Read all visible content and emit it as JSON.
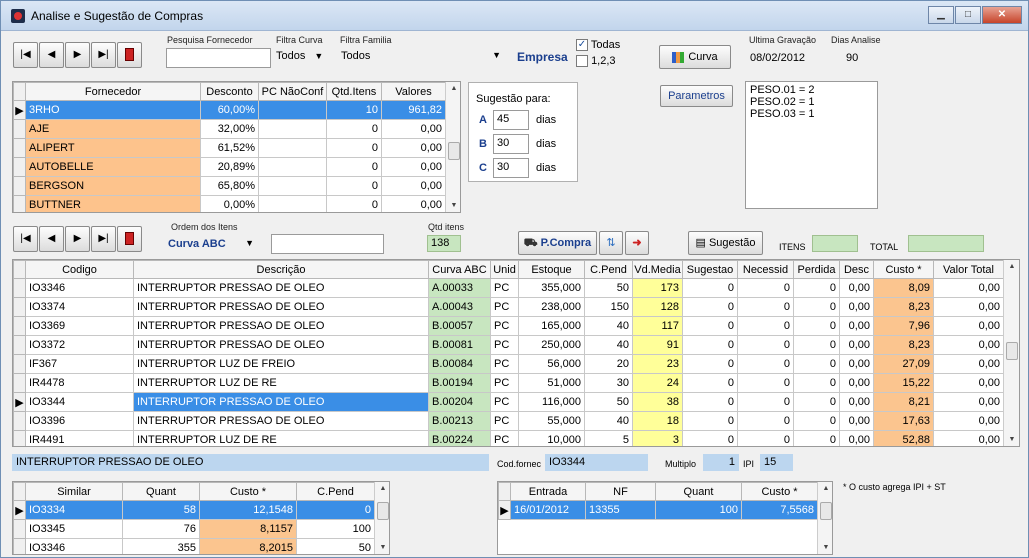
{
  "window": {
    "title": "Analise e Sugestão de Compras"
  },
  "top": {
    "pesquisa_label": "Pesquisa Fornecedor",
    "pesquisa_value": "",
    "filtra_curva_label": "Filtra Curva",
    "filtra_curva_value": "Todos",
    "filtra_familia_label": "Filtra Familia",
    "filtra_familia_value": "Todos",
    "empresa_label": "Empresa",
    "todas_label": "Todas",
    "todas_checked": true,
    "opt123_label": "1,2,3",
    "opt123_checked": false,
    "curva_button": "Curva",
    "ultima_label": "Ultima Gravação",
    "ultima_value": "08/02/2012",
    "dias_label": "Dias Analise",
    "dias_value": "90"
  },
  "fornecedores": {
    "headers": [
      "Fornecedor",
      "Desconto",
      "PC NãoConf",
      "Qtd.Itens",
      "Valores"
    ],
    "rows": [
      {
        "nome": "3RHO",
        "desconto": "60,00%",
        "pc": "",
        "qtd": "10",
        "valor": "961,82"
      },
      {
        "nome": "AJE",
        "desconto": "32,00%",
        "pc": "",
        "qtd": "0",
        "valor": "0,00"
      },
      {
        "nome": "ALIPERT",
        "desconto": "61,52%",
        "pc": "",
        "qtd": "0",
        "valor": "0,00"
      },
      {
        "nome": "AUTOBELLE",
        "desconto": "20,89%",
        "pc": "",
        "qtd": "0",
        "valor": "0,00"
      },
      {
        "nome": "BERGSON",
        "desconto": "65,80%",
        "pc": "",
        "qtd": "0",
        "valor": "0,00"
      },
      {
        "nome": "BUTTNER",
        "desconto": "0,00%",
        "pc": "",
        "qtd": "0",
        "valor": "0,00"
      }
    ]
  },
  "sugestao": {
    "title": "Sugestão para:",
    "unit": "dias",
    "a_label": "A",
    "a_value": "45",
    "b_label": "B",
    "b_value": "30",
    "c_label": "C",
    "c_value": "30"
  },
  "parametros": {
    "button": "Parametros",
    "lines": [
      "PESO.01 = 2",
      "PESO.02 = 1",
      "PESO.03 = 1"
    ]
  },
  "itens_bar": {
    "ordem_label": "Ordem dos Itens",
    "ordem_value": "Curva ABC",
    "ordem_search": "",
    "qtd_label": "Qtd itens",
    "qtd_value": "138",
    "pcompra_button": "P.Compra",
    "sugestao_button": "Sugestão",
    "itens_label": "ITENS",
    "itens_value": "",
    "total_label": "TOTAL",
    "total_value": ""
  },
  "itens": {
    "headers": [
      "Codigo",
      "Descrição",
      "Curva ABC",
      "Unid",
      "Estoque",
      "C.Pend",
      "Vd.Media",
      "Sugestao",
      "Necessid",
      "Perdida",
      "Desc",
      "Custo *",
      "Valor Total"
    ],
    "rows": [
      {
        "codigo": "IO3346",
        "descricao": "INTERRUPTOR PRESSAO DE OLEO",
        "curva": "A.00033",
        "unid": "PC",
        "estoque": "355,000",
        "cpend": "50",
        "vd": "173",
        "sug": "0",
        "nec": "0",
        "per": "0",
        "desc": "0,00",
        "custo": "8,09",
        "valor": "0,00"
      },
      {
        "codigo": "IO3374",
        "descricao": "INTERRUPTOR PRESSAO DE OLEO",
        "curva": "A.00043",
        "unid": "PC",
        "estoque": "238,000",
        "cpend": "150",
        "vd": "128",
        "sug": "0",
        "nec": "0",
        "per": "0",
        "desc": "0,00",
        "custo": "8,23",
        "valor": "0,00"
      },
      {
        "codigo": "IO3369",
        "descricao": "INTERRUPTOR PRESSAO DE OLEO",
        "curva": "B.00057",
        "unid": "PC",
        "estoque": "165,000",
        "cpend": "40",
        "vd": "117",
        "sug": "0",
        "nec": "0",
        "per": "0",
        "desc": "0,00",
        "custo": "7,96",
        "valor": "0,00"
      },
      {
        "codigo": "IO3372",
        "descricao": "INTERRUPTOR PRESSAO DE OLEO",
        "curva": "B.00081",
        "unid": "PC",
        "estoque": "250,000",
        "cpend": "40",
        "vd": "91",
        "sug": "0",
        "nec": "0",
        "per": "0",
        "desc": "0,00",
        "custo": "8,23",
        "valor": "0,00"
      },
      {
        "codigo": "IF367",
        "descricao": "INTERRUPTOR LUZ DE FREIO",
        "curva": "B.00084",
        "unid": "PC",
        "estoque": "56,000",
        "cpend": "20",
        "vd": "23",
        "sug": "0",
        "nec": "0",
        "per": "0",
        "desc": "0,00",
        "custo": "27,09",
        "valor": "0,00"
      },
      {
        "codigo": "IR4478",
        "descricao": "INTERRUPTOR LUZ DE RE",
        "curva": "B.00194",
        "unid": "PC",
        "estoque": "51,000",
        "cpend": "30",
        "vd": "24",
        "sug": "0",
        "nec": "0",
        "per": "0",
        "desc": "0,00",
        "custo": "15,22",
        "valor": "0,00"
      },
      {
        "codigo": "IO3344",
        "descricao": "INTERRUPTOR PRESSAO DE OLEO",
        "curva": "B.00204",
        "unid": "PC",
        "estoque": "116,000",
        "cpend": "50",
        "vd": "38",
        "sug": "0",
        "nec": "0",
        "per": "0",
        "desc": "0,00",
        "custo": "8,21",
        "valor": "0,00"
      },
      {
        "codigo": "IO3396",
        "descricao": "INTERRUPTOR PRESSAO DE OLEO",
        "curva": "B.00213",
        "unid": "PC",
        "estoque": "55,000",
        "cpend": "40",
        "vd": "18",
        "sug": "0",
        "nec": "0",
        "per": "0",
        "desc": "0,00",
        "custo": "17,63",
        "valor": "0,00"
      },
      {
        "codigo": "IR4491",
        "descricao": "INTERRUPTOR LUZ DE RE",
        "curva": "B.00224",
        "unid": "PC",
        "estoque": "10,000",
        "cpend": "5",
        "vd": "3",
        "sug": "0",
        "nec": "0",
        "per": "0",
        "desc": "0,00",
        "custo": "52,88",
        "valor": "0,00"
      }
    ]
  },
  "detail": {
    "descricao": "INTERRUPTOR PRESSAO DE OLEO",
    "codfornec_label": "Cod.fornec",
    "codfornec_value": "IO3344",
    "multiplo_label": "Multiplo",
    "multiplo_value": "1",
    "ipi_label": "IPI",
    "ipi_value": "15"
  },
  "similar": {
    "headers": [
      "Similar",
      "Quant",
      "Custo *",
      "C.Pend"
    ],
    "rows": [
      {
        "codigo": "IO3334",
        "quant": "58",
        "custo": "12,1548",
        "cpend": "0"
      },
      {
        "codigo": "IO3345",
        "quant": "76",
        "custo": "8,1157",
        "cpend": "100"
      },
      {
        "codigo": "IO3346",
        "quant": "355",
        "custo": "8,2015",
        "cpend": "50"
      }
    ]
  },
  "entradas": {
    "headers": [
      "Entrada",
      "NF",
      "Quant",
      "Custo *"
    ],
    "rows": [
      {
        "entrada": "16/01/2012",
        "nf": "13355",
        "quant": "100",
        "custo": "7,5568"
      }
    ]
  },
  "note": "* O custo agrega IPI + ST"
}
